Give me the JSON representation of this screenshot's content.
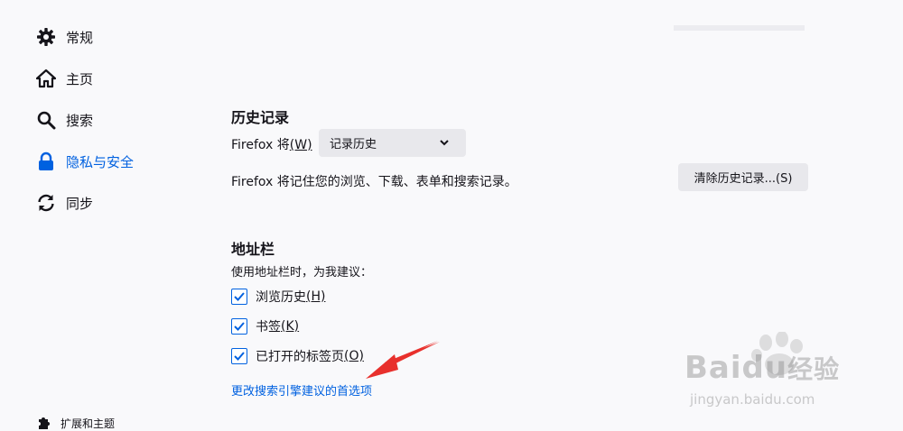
{
  "sidebar": {
    "items": [
      {
        "label": "常规",
        "icon": "gear-icon"
      },
      {
        "label": "主页",
        "icon": "home-icon"
      },
      {
        "label": "搜索",
        "icon": "search-icon"
      },
      {
        "label": "隐私与安全",
        "icon": "lock-icon"
      },
      {
        "label": "同步",
        "icon": "sync-icon"
      }
    ],
    "selected_index": 3,
    "footer": {
      "label": "扩展和主题",
      "icon": "puzzle-icon"
    }
  },
  "history": {
    "title": "历史记录",
    "firefox_will_label": "Firefox 将",
    "firefox_will_key": "(W)",
    "select_value": "记录历史",
    "description": "Firefox 将记住您的浏览、下载、表单和搜索记录。",
    "clear_button": "清除历史记录...(S)"
  },
  "addressbar": {
    "title": "地址栏",
    "subtitle": "使用地址栏时，为我建议：",
    "options": [
      {
        "label": "浏览历史",
        "key": "(H)",
        "checked": true
      },
      {
        "label": "书签",
        "key": "(K)",
        "checked": true
      },
      {
        "label": "已打开的标签页",
        "key": "(O)",
        "checked": true
      }
    ],
    "change_link": "更改搜索引擎建议的首选项"
  },
  "watermark": {
    "brand": "Baidu",
    "brand_cn": "经验",
    "url": "jingyan.baidu.com"
  },
  "colors": {
    "accent": "#0061e0",
    "arrow": "#e8302c",
    "background": "#f9f9fb",
    "button_bg": "#e8e8ec"
  }
}
